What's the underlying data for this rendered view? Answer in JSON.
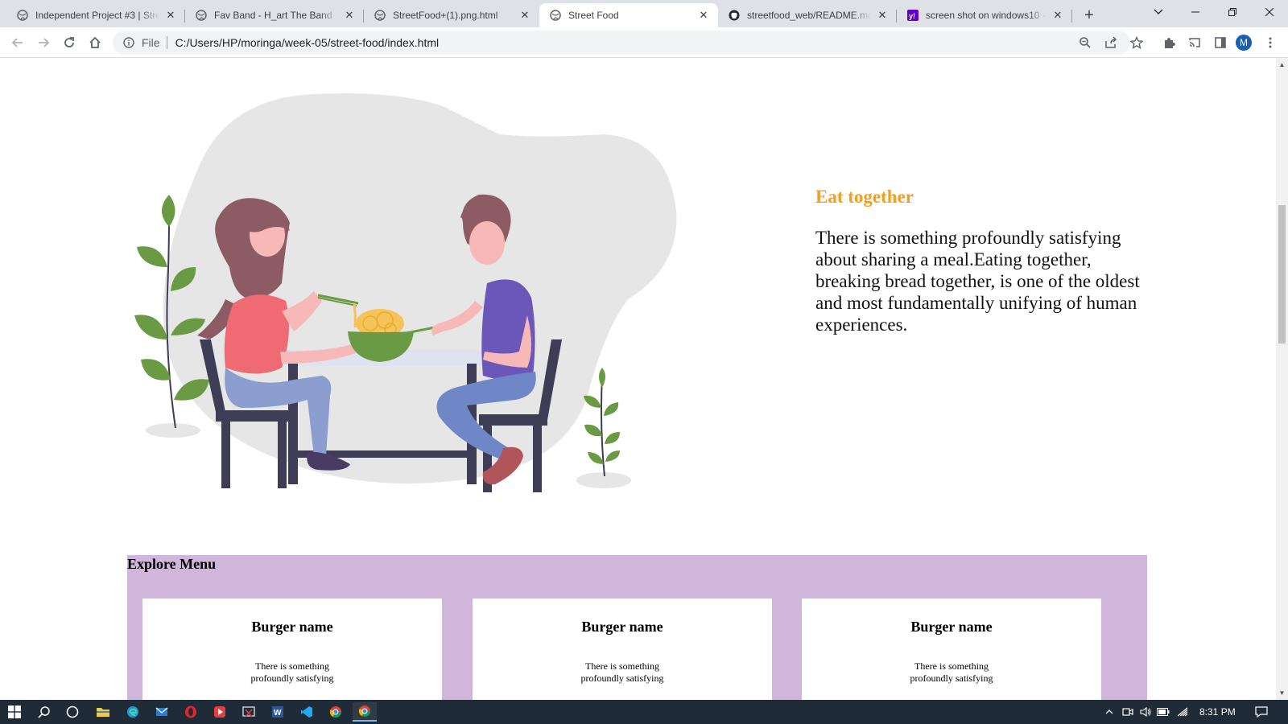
{
  "browser": {
    "tabs": [
      {
        "title": "Independent Project #3 | Stre",
        "icon": "globe-icon"
      },
      {
        "title": "Fav Band - H_art The Band",
        "icon": "globe-icon"
      },
      {
        "title": "StreetFood+(1).png.html",
        "icon": "globe-icon"
      },
      {
        "title": "Street Food",
        "icon": "globe-icon",
        "active": true
      },
      {
        "title": "streetfood_web/README.md",
        "icon": "github-icon"
      },
      {
        "title": "screen shot on windows10 - Y",
        "icon": "yahoo-icon"
      }
    ],
    "address": {
      "scheme_label": "File",
      "url": "C:/Users/HP/moringa/week-05/street-food/index.html"
    },
    "profile_initial": "M"
  },
  "page": {
    "intro": {
      "title": "Eat together",
      "text": "There is something profoundly satisfying about sharing a meal.Eating together, breaking bread together, is one of the oldest and most fundamentally unifying of human experiences."
    },
    "menu": {
      "title": "Explore Menu",
      "cards": [
        {
          "name": "Burger name",
          "text": "There is something profoundly satisfying"
        },
        {
          "name": "Burger name",
          "text": "There is something profoundly satisfying"
        },
        {
          "name": "Burger name",
          "text": "There is something profoundly satisfying"
        }
      ]
    }
  },
  "taskbar": {
    "clock": "8:31 PM"
  },
  "colors": {
    "accent_title": "#f0a020",
    "menu_background": "#d1b6dc",
    "tabstrip": "#dee1e6"
  }
}
